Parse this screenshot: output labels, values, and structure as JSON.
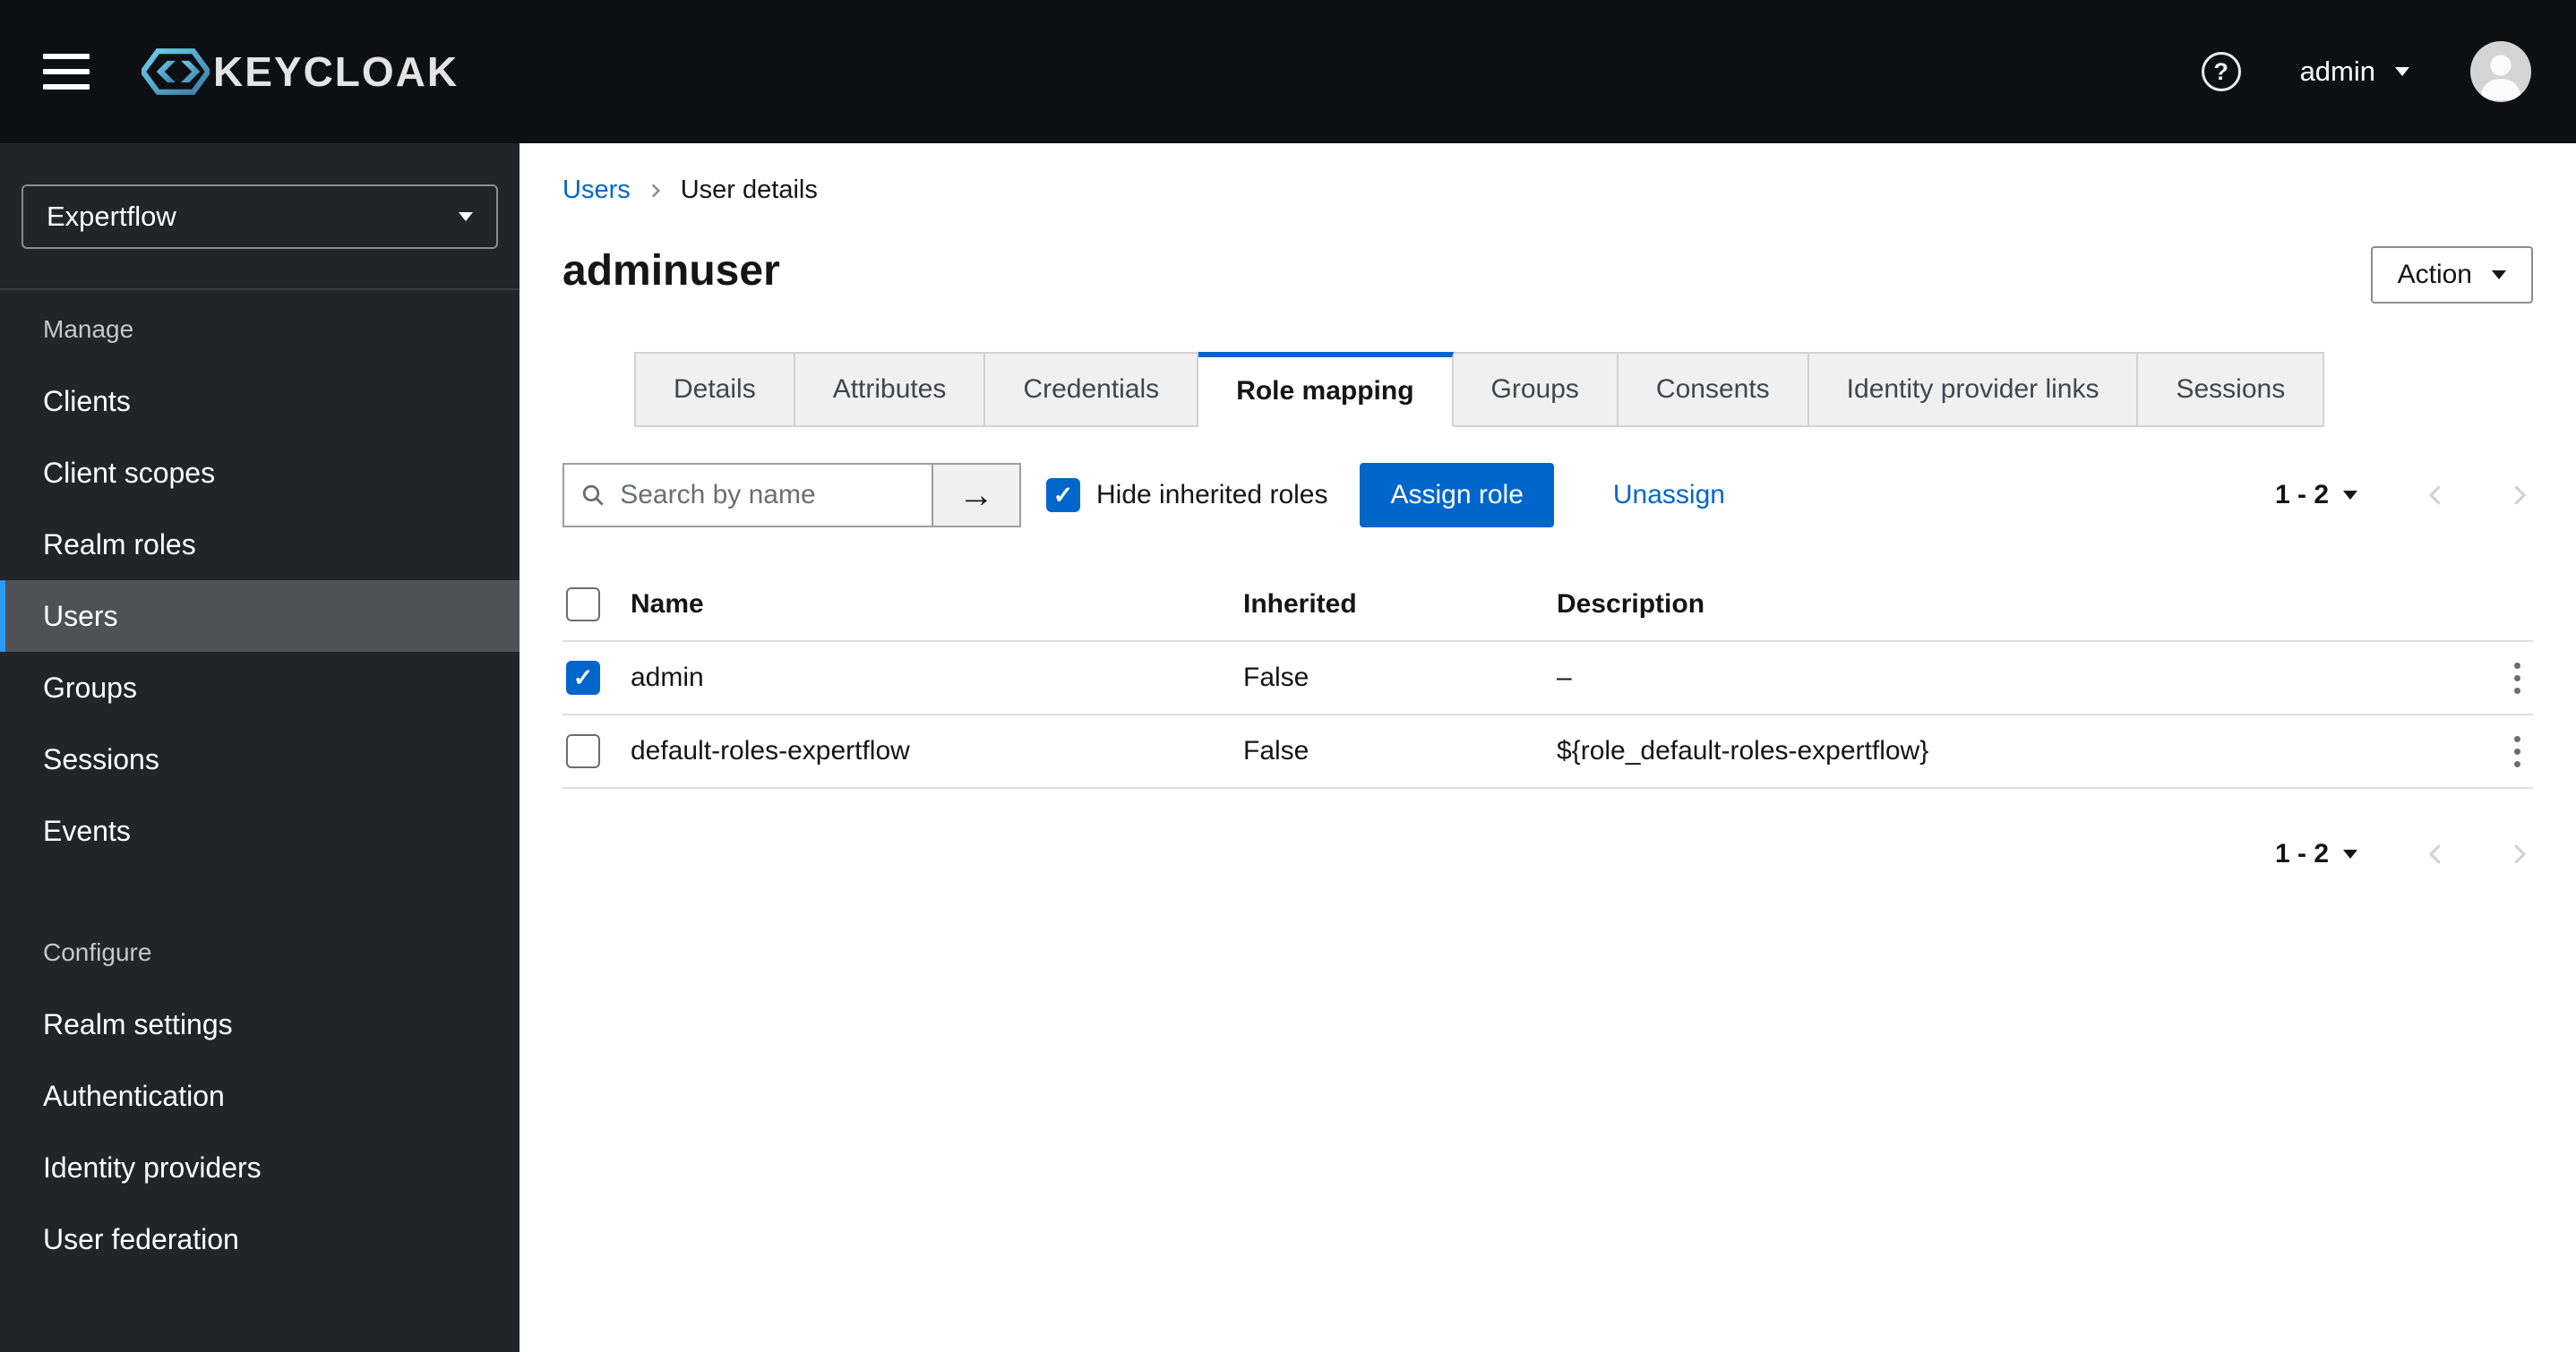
{
  "masthead": {
    "brand": "KEYCLOAK",
    "help_glyph": "?",
    "username": "admin"
  },
  "sidebar": {
    "realm": "Expertflow",
    "sections": [
      {
        "label": "Manage",
        "items": [
          {
            "label": "Clients",
            "active": false
          },
          {
            "label": "Client scopes",
            "active": false
          },
          {
            "label": "Realm roles",
            "active": false
          },
          {
            "label": "Users",
            "active": true
          },
          {
            "label": "Groups",
            "active": false
          },
          {
            "label": "Sessions",
            "active": false
          },
          {
            "label": "Events",
            "active": false
          }
        ]
      },
      {
        "label": "Configure",
        "items": [
          {
            "label": "Realm settings",
            "active": false
          },
          {
            "label": "Authentication",
            "active": false
          },
          {
            "label": "Identity providers",
            "active": false
          },
          {
            "label": "User federation",
            "active": false
          }
        ]
      }
    ]
  },
  "breadcrumb": {
    "parent": "Users",
    "current": "User details"
  },
  "page": {
    "title": "adminuser",
    "action_label": "Action"
  },
  "tabs": [
    {
      "label": "Details",
      "active": false
    },
    {
      "label": "Attributes",
      "active": false
    },
    {
      "label": "Credentials",
      "active": false
    },
    {
      "label": "Role mapping",
      "active": true
    },
    {
      "label": "Groups",
      "active": false
    },
    {
      "label": "Consents",
      "active": false
    },
    {
      "label": "Identity provider links",
      "active": false
    },
    {
      "label": "Sessions",
      "active": false
    }
  ],
  "toolbar": {
    "search_placeholder": "Search by name",
    "search_button_glyph": "→",
    "hide_inherited": {
      "label": "Hide inherited roles",
      "checked": true
    },
    "assign_label": "Assign role",
    "unassign_label": "Unassign",
    "pagination_range": "1 - 2"
  },
  "table": {
    "columns": {
      "name": "Name",
      "inherited": "Inherited",
      "description": "Description"
    },
    "rows": [
      {
        "name": "admin",
        "inherited": "False",
        "description": "–",
        "checked": true
      },
      {
        "name": "default-roles-expertflow",
        "inherited": "False",
        "description": "${role_default-roles-expertflow}",
        "checked": false
      }
    ]
  },
  "pagination_bottom": {
    "range": "1 - 2"
  },
  "colors": {
    "primary": "#0066cc",
    "link": "#0066cc",
    "active_nav_stripe": "#2b9af3",
    "masthead_bg": "#0d0f12",
    "sidebar_bg": "#212528"
  }
}
